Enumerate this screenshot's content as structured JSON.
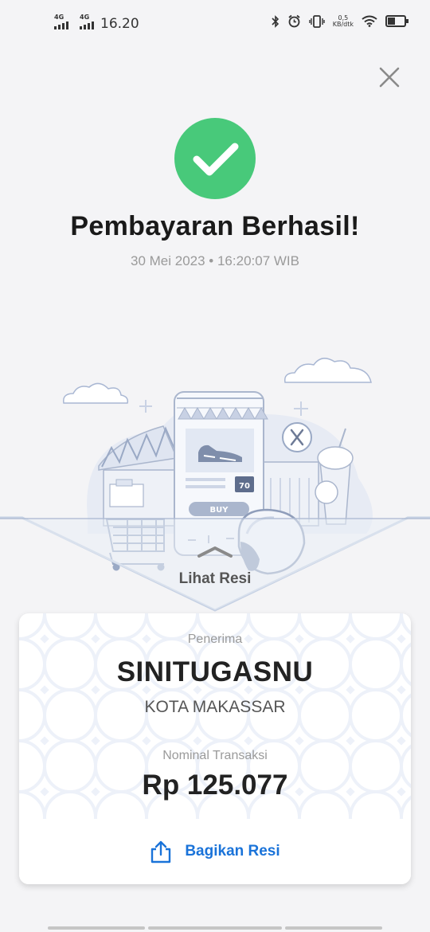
{
  "status_bar": {
    "net1": "4G",
    "net2": "4G",
    "time": "16.20",
    "speed_value": "0,5",
    "speed_unit": "KB/dtk"
  },
  "header": {
    "title": "Pembayaran Berhasil!",
    "datetime": "30 Mei 2023 • 16:20:07 WIB"
  },
  "illustration": {
    "discount": "70",
    "buy_label": "BUY"
  },
  "receipt_link": {
    "label": "Lihat Resi"
  },
  "recipient": {
    "label": "Penerima",
    "name": "SINITUGASNU",
    "city": "KOTA MAKASSAR",
    "amount_label": "Nominal Transaksi",
    "amount": "Rp 125.077"
  },
  "share": {
    "label": "Bagikan Resi"
  },
  "colors": {
    "success": "#48c97a",
    "accent": "#1a73d9",
    "background": "#f4f4f6"
  },
  "icons": [
    "close-icon",
    "check-icon",
    "share-icon",
    "bluetooth-icon",
    "alarm-icon",
    "vibrate-icon",
    "wifi-icon",
    "battery-icon"
  ]
}
